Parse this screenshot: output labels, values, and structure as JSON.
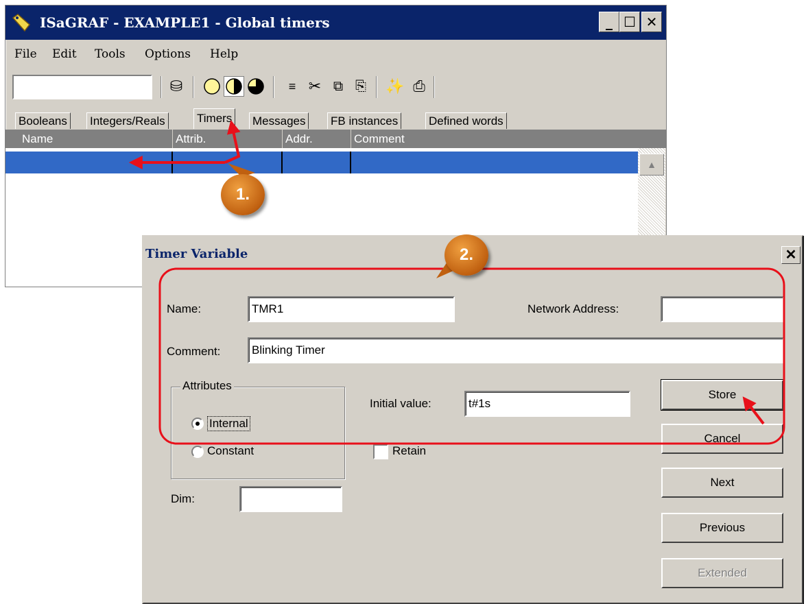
{
  "main_window": {
    "title": "ISaGRAF - EXAMPLE1 - Global timers",
    "menu": [
      "File",
      "Edit",
      "Tools",
      "Options",
      "Help"
    ],
    "tabs": [
      "Booleans",
      "Integers/Reals",
      "Timers",
      "Messages",
      "FB instances",
      "Defined words"
    ],
    "active_tab": "Timers",
    "columns": [
      "Name",
      "Attrib.",
      "Addr.",
      "Comment"
    ]
  },
  "dialog": {
    "title": "Timer Variable",
    "name_label": "Name:",
    "name_value": "TMR1",
    "network_address_label": "Network Address:",
    "network_address_value": "",
    "comment_label": "Comment:",
    "comment_value": "Blinking Timer",
    "attributes_label": "Attributes",
    "radio_internal": "Internal",
    "radio_constant": "Constant",
    "selected_attribute": "Internal",
    "initial_value_label": "Initial value:",
    "initial_value": "t#1s",
    "retain_label": "Retain",
    "retain_checked": false,
    "dim_label": "Dim:",
    "dim_value": "",
    "buttons": {
      "store": "Store",
      "cancel": "Cancel",
      "next": "Next",
      "previous": "Previous",
      "extended": "Extended"
    }
  },
  "annotations": {
    "step1": "1.",
    "step2": "2.",
    "highlight_color": "#e8101a",
    "badge_color": "#d0701a"
  }
}
